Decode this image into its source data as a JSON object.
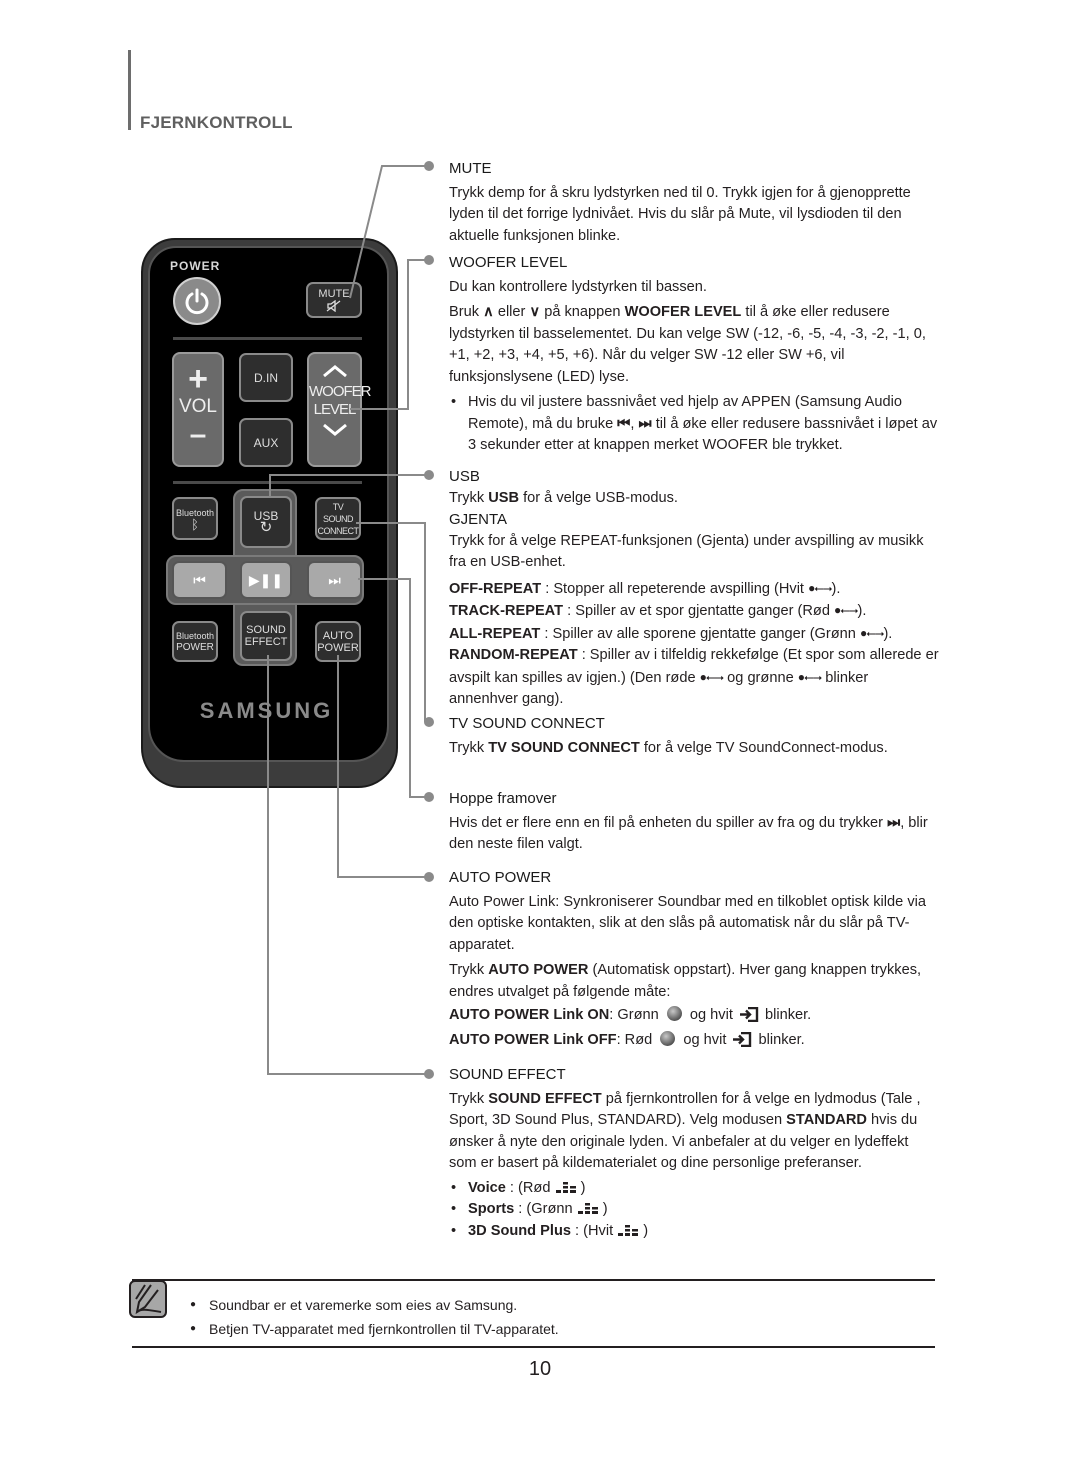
{
  "section_title": "FJERNKONTROLL",
  "remote": {
    "power_label": "POWER",
    "mute_label": "MUTE",
    "vol_plus": "+",
    "vol_label": "VOL",
    "vol_minus": "–",
    "din_label": "D.IN",
    "aux_label": "AUX",
    "woofer_label_1": "WOOFER",
    "woofer_label_2": "LEVEL",
    "bluetooth_label": "Bluetooth",
    "usb_label": "USB",
    "tv_sound_1": "TV SOUND",
    "tv_sound_2": "CONNECT",
    "bt_power_1": "Bluetooth",
    "bt_power_2": "POWER",
    "sound_effect_1": "SOUND",
    "sound_effect_2": "EFFECT",
    "auto_power_1": "AUTO",
    "auto_power_2": "POWER",
    "brand": "SAMSUNG"
  },
  "mute": {
    "heading": "MUTE",
    "text": "Trykk demp for å skru lydstyrken ned til 0. Trykk igjen for å gjenopprette lyden til det forrige lydnivået. Hvis du slår på Mute, vil lysdioden til den aktuelle funksjonen blinke."
  },
  "woofer": {
    "heading": "WOOFER LEVEL",
    "intro": "Du kan kontrollere lydstyrken til bassen.",
    "bruk": "Bruk",
    "eller": "eller",
    "pa_knappen": "på knappen",
    "bold_name": "WOOFER LEVEL",
    "rest": "til å øke eller redusere lydstyrken til basselementet. Du kan velge SW (-12, -6, -5, -4, -3, -2, -1, 0, +1, +2, +3, +4, +5, +6). Når du velger SW -12 eller SW +6, vil funksjonslysene (LED) lyse.",
    "bullet_a": "Hvis du vil justere bassnivået ved hjelp av APPEN (Samsung Audio Remote), må du bruke",
    "bullet_b": "til å øke eller redusere bassnivået i løpet av 3 sekunder etter at knappen merket WOOFER ble trykket."
  },
  "usb": {
    "heading": "USB",
    "trykk": "Trykk",
    "usb_bold": "USB",
    "rest": "for å velge USB-modus.",
    "gjenta_heading": "GJENTA",
    "gjenta_text": "Trykk for å velge REPEAT-funksjonen (Gjenta) under avspilling av musikk fra en USB-enhet.",
    "modes": [
      {
        "name": "OFF-REPEAT",
        "desc": ": Stopper all repeterende avspilling (Hvit",
        "end": ")."
      },
      {
        "name": "TRACK-REPEAT",
        "desc": ": Spiller av et spor gjentatte ganger (Rød",
        "end": ")."
      },
      {
        "name": "ALL-REPEAT",
        "desc": ": Spiller av alle sporene gjentatte ganger (Grønn",
        "end": ")."
      },
      {
        "name": "RANDOM-REPEAT",
        "desc": ": Spiller av i tilfeldig rekkefølge (Et spor som allerede er avspilt kan spilles av igjen.) (Den røde",
        "mid": "og grønne",
        "end": "blinker annenhver gang)."
      }
    ]
  },
  "tv_sound": {
    "heading": "TV SOUND CONNECT",
    "trykk": "Trykk",
    "bold": "TV SOUND CONNECT",
    "rest": "for å velge TV SoundConnect-modus."
  },
  "skip": {
    "heading": "Hoppe framover",
    "text_a": "Hvis det er flere enn en fil på enheten du spiller av fra og du trykker",
    "text_b": ", blir den neste filen valgt."
  },
  "auto_power": {
    "heading": "AUTO POWER",
    "intro": "Auto Power Link: Synkroniserer Soundbar med en tilkoblet optisk kilde via den optiske kontakten, slik at den slås på automatisk når du slår på TV-apparatet.",
    "trykk": "Trykk",
    "bold": "AUTO POWER",
    "rest": "(Automatisk oppstart). Hver gang knappen trykkes, endres utvalget på følgende måte:",
    "on_label": "AUTO POWER Link ON",
    "on_color": ": Grønn",
    "off_label": "AUTO POWER Link OFF",
    "off_color": ": Rød",
    "og_hvit": "og hvit",
    "blinker": "blinker."
  },
  "sound_effect": {
    "heading": "SOUND EFFECT",
    "trykk": "Trykk",
    "bold": "SOUND EFFECT",
    "text_a": "på fjernkontrollen for å velge en lydmodus (Tale , Sport, 3D Sound Plus, STANDARD). Velg modusen",
    "standard": "STANDARD",
    "text_b": "hvis du ønsker å nyte den originale lyden. Vi anbefaler at du velger en lydeffekt som er basert på kildematerialet og dine personlige preferanser.",
    "modes": [
      {
        "name": "Voice",
        "color": ": (Rød"
      },
      {
        "name": "Sports",
        "color": ": (Grønn"
      },
      {
        "name": "3D Sound Plus",
        "color": ": (Hvit"
      }
    ]
  },
  "notes": [
    "Soundbar er et varemerke som eies av Samsung.",
    "Betjen TV-apparatet med fjernkontrollen til TV-apparatet."
  ],
  "page_number": "10"
}
